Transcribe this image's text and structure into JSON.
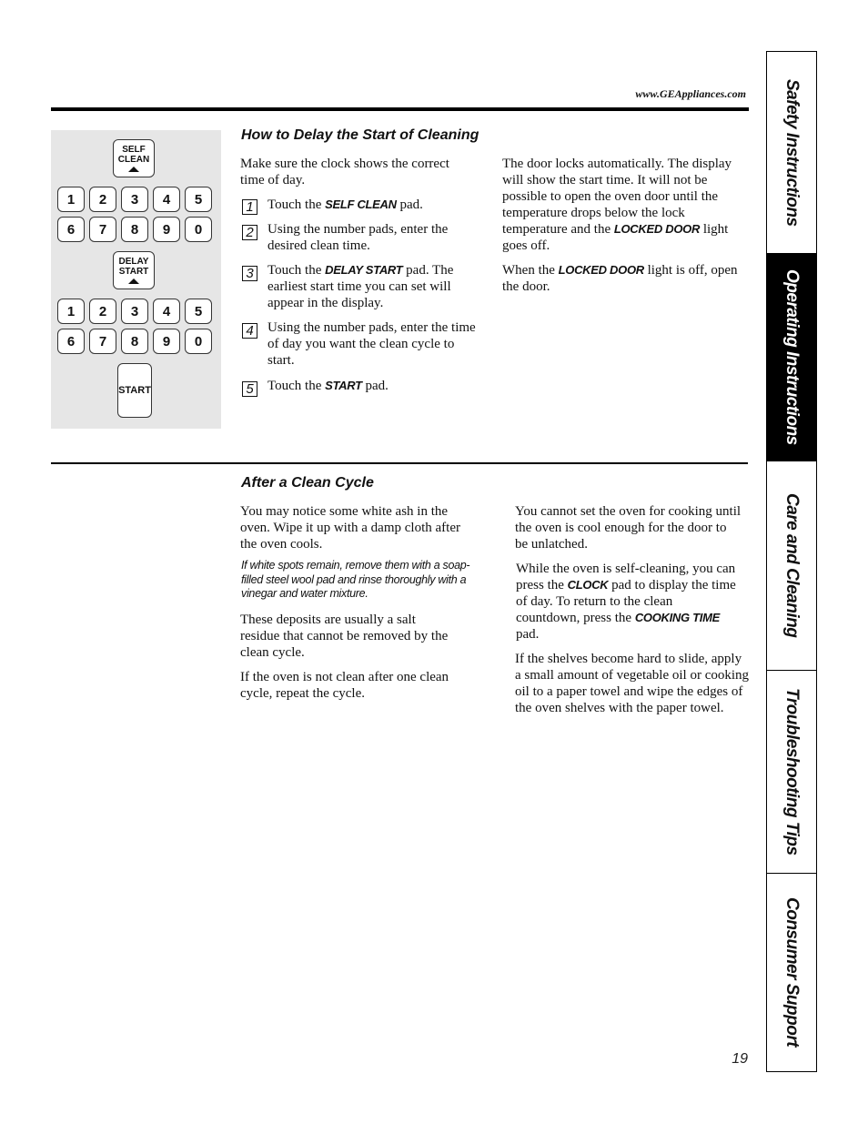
{
  "header": {
    "url": "www.GEAppliances.com"
  },
  "keypad": {
    "self_clean": [
      "SELF",
      "CLEAN"
    ],
    "delay_start": [
      "DELAY",
      "START"
    ],
    "start": "START",
    "digits_row1": [
      "1",
      "2",
      "3",
      "4",
      "5"
    ],
    "digits_row2": [
      "6",
      "7",
      "8",
      "9",
      "0"
    ]
  },
  "delay_section": {
    "title": "How to Delay the Start of Cleaning",
    "intro": "Make sure the clock shows the correct time of day.",
    "steps": [
      {
        "num": "1",
        "pre": "Touch the ",
        "bold": "SELF CLEAN",
        "post": " pad."
      },
      {
        "num": "2",
        "text": "Using the number pads, enter the desired clean time."
      },
      {
        "num": "3",
        "pre": "Touch the ",
        "bold": "DELAY START",
        "post": " pad. The earliest start time you can set will appear in the display."
      },
      {
        "num": "4",
        "text": "Using the number pads, enter the time of day you want the clean cycle to start."
      },
      {
        "num": "5",
        "pre": "Touch the ",
        "bold": "START",
        "post": " pad."
      }
    ],
    "right_p1_pre": "The door locks automatically. The display will show the start time. It will not be possible to open the oven door until the temperature drops below the lock temperature and the ",
    "right_p1_bold": "LOCKED DOOR",
    "right_p1_post": " light goes off.",
    "right_p2_pre": "When the ",
    "right_p2_bold": "LOCKED DOOR",
    "right_p2_post": " light is off, open the door."
  },
  "after_section": {
    "title": "After a Clean Cycle",
    "p1": "You may notice some white ash in the oven. Wipe it up with a damp cloth after the oven cools.",
    "note": "If white spots remain, remove them with a soap-filled steel wool pad and rinse thoroughly with a vinegar and water mixture.",
    "p2": "These deposits are usually a salt residue that cannot be removed by the clean cycle.",
    "p3": "If the oven is not clean after one clean cycle, repeat the cycle.",
    "r1": "You cannot set the oven for cooking until the oven is cool enough for the door to be unlatched.",
    "r2_pre": "While the oven is self-cleaning, you can press the ",
    "r2_bold1": "CLOCK",
    "r2_mid": " pad to display the time of day. To return to the clean countdown, press the ",
    "r2_bold2": "COOKING TIME",
    "r2_post": " pad.",
    "r3": "If the shelves become hard to slide, apply a small amount of vegetable oil or cooking oil to a paper towel and wipe the edges of the oven shelves with the paper towel."
  },
  "tabs": [
    {
      "label": "Safety Instructions",
      "active": false
    },
    {
      "label": "Operating Instructions",
      "active": true
    },
    {
      "label": "Care and Cleaning",
      "active": false
    },
    {
      "label": "Troubleshooting Tips",
      "active": false
    },
    {
      "label": "Consumer Support",
      "active": false
    }
  ],
  "footer": {
    "page_number": "19"
  }
}
